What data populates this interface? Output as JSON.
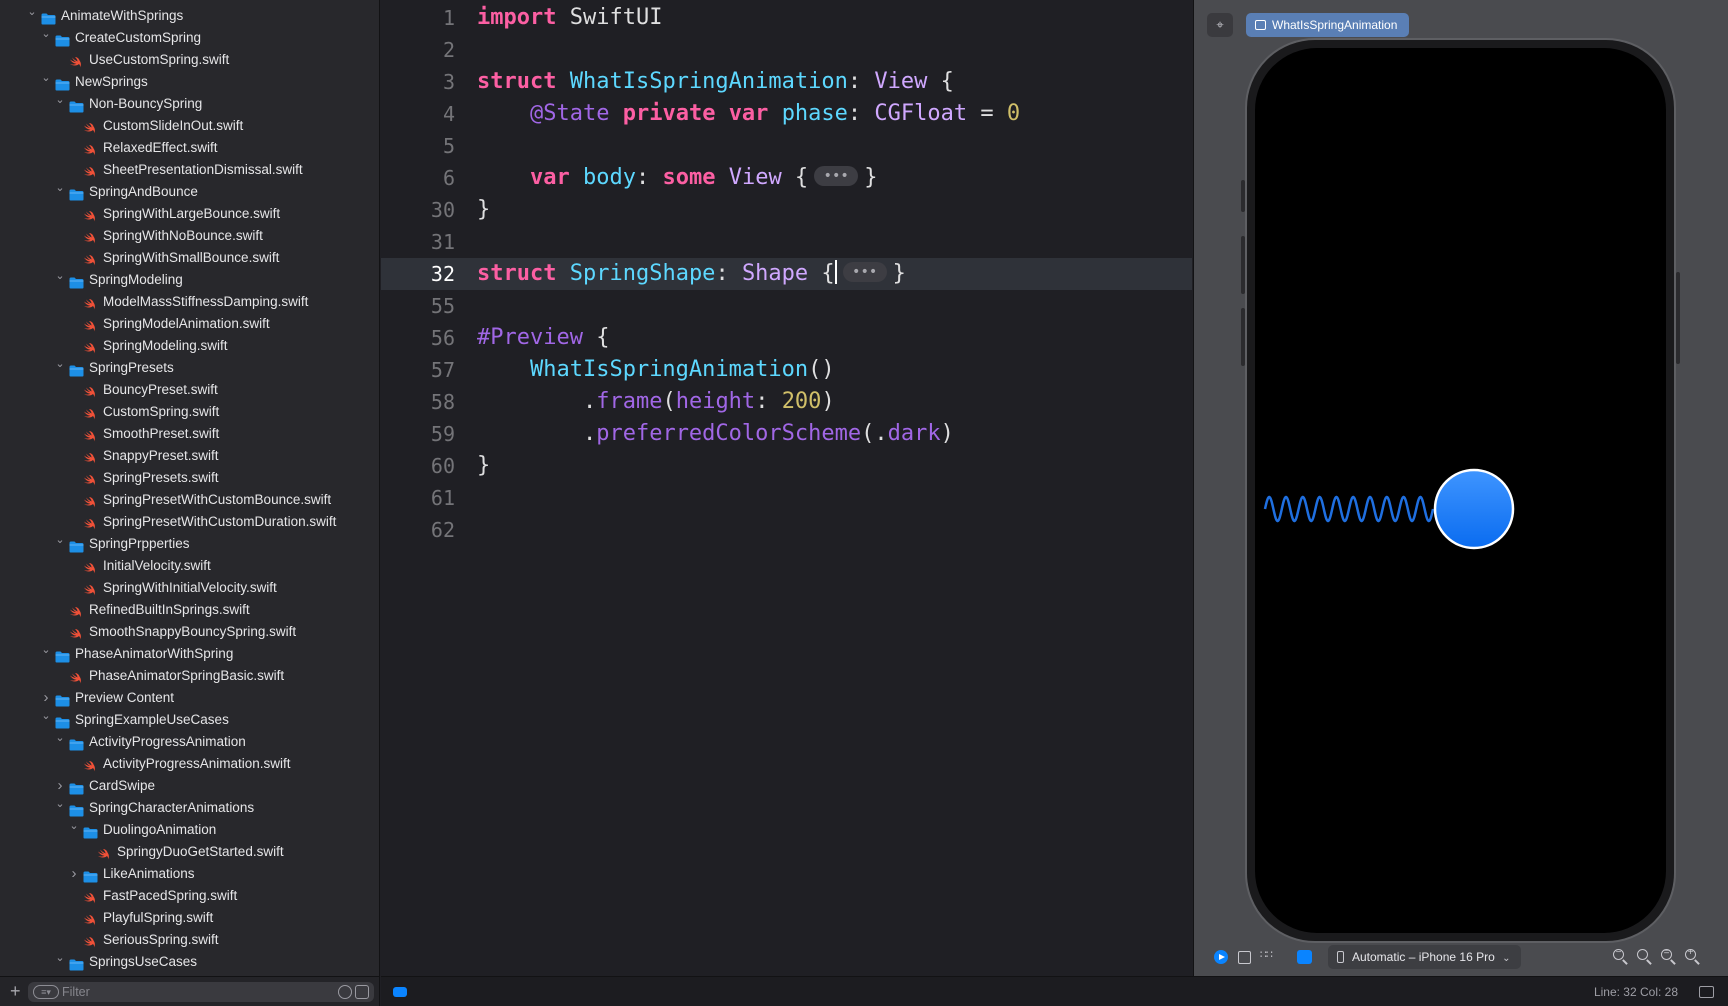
{
  "navigator": {
    "items": [
      {
        "label": "AnimateWithSprings",
        "type": "folder",
        "depth": 1,
        "expanded": true
      },
      {
        "label": "CreateCustomSpring",
        "type": "folder",
        "depth": 2,
        "expanded": true
      },
      {
        "label": "UseCustomSpring.swift",
        "type": "swift",
        "depth": 3
      },
      {
        "label": "NewSprings",
        "type": "folder",
        "depth": 2,
        "expanded": true
      },
      {
        "label": "Non-BouncySpring",
        "type": "folder",
        "depth": 3,
        "expanded": true
      },
      {
        "label": "CustomSlideInOut.swift",
        "type": "swift",
        "depth": 4
      },
      {
        "label": "RelaxedEffect.swift",
        "type": "swift",
        "depth": 4
      },
      {
        "label": "SheetPresentationDismissal.swift",
        "type": "swift",
        "depth": 4
      },
      {
        "label": "SpringAndBounce",
        "type": "folder",
        "depth": 3,
        "expanded": true
      },
      {
        "label": "SpringWithLargeBounce.swift",
        "type": "swift",
        "depth": 4
      },
      {
        "label": "SpringWithNoBounce.swift",
        "type": "swift",
        "depth": 4
      },
      {
        "label": "SpringWithSmallBounce.swift",
        "type": "swift",
        "depth": 4
      },
      {
        "label": "SpringModeling",
        "type": "folder",
        "depth": 3,
        "expanded": true
      },
      {
        "label": "ModelMassStiffnessDamping.swift",
        "type": "swift",
        "depth": 4
      },
      {
        "label": "SpringModelAnimation.swift",
        "type": "swift",
        "depth": 4
      },
      {
        "label": "SpringModeling.swift",
        "type": "swift",
        "depth": 4
      },
      {
        "label": "SpringPresets",
        "type": "folder",
        "depth": 3,
        "expanded": true
      },
      {
        "label": "BouncyPreset.swift",
        "type": "swift",
        "depth": 4
      },
      {
        "label": "CustomSpring.swift",
        "type": "swift",
        "depth": 4
      },
      {
        "label": "SmoothPreset.swift",
        "type": "swift",
        "depth": 4
      },
      {
        "label": "SnappyPreset.swift",
        "type": "swift",
        "depth": 4
      },
      {
        "label": "SpringPresets.swift",
        "type": "swift",
        "depth": 4
      },
      {
        "label": "SpringPresetWithCustomBounce.swift",
        "type": "swift",
        "depth": 4
      },
      {
        "label": "SpringPresetWithCustomDuration.swift",
        "type": "swift",
        "depth": 4
      },
      {
        "label": "SpringPrpperties",
        "type": "folder",
        "depth": 3,
        "expanded": true
      },
      {
        "label": "InitialVelocity.swift",
        "type": "swift",
        "depth": 4
      },
      {
        "label": "SpringWithInitialVelocity.swift",
        "type": "swift",
        "depth": 4
      },
      {
        "label": "RefinedBuiltInSprings.swift",
        "type": "swift",
        "depth": 3
      },
      {
        "label": "SmoothSnappyBouncySpring.swift",
        "type": "swift",
        "depth": 3
      },
      {
        "label": "PhaseAnimatorWithSpring",
        "type": "folder",
        "depth": 2,
        "expanded": true
      },
      {
        "label": "PhaseAnimatorSpringBasic.swift",
        "type": "swift",
        "depth": 3
      },
      {
        "label": "Preview Content",
        "type": "folder",
        "depth": 2,
        "expanded": false
      },
      {
        "label": "SpringExampleUseCases",
        "type": "folder",
        "depth": 2,
        "expanded": true
      },
      {
        "label": "ActivityProgressAnimation",
        "type": "folder",
        "depth": 3,
        "expanded": true
      },
      {
        "label": "ActivityProgressAnimation.swift",
        "type": "swift",
        "depth": 4
      },
      {
        "label": "CardSwipe",
        "type": "folder",
        "depth": 3,
        "expanded": false
      },
      {
        "label": "SpringCharacterAnimations",
        "type": "folder",
        "depth": 3,
        "expanded": true
      },
      {
        "label": "DuolingoAnimation",
        "type": "folder",
        "depth": 4,
        "expanded": true
      },
      {
        "label": "SpringyDuoGetStarted.swift",
        "type": "swift",
        "depth": 5
      },
      {
        "label": "LikeAnimations",
        "type": "folder",
        "depth": 4,
        "expanded": false
      },
      {
        "label": "FastPacedSpring.swift",
        "type": "swift",
        "depth": 4
      },
      {
        "label": "PlayfulSpring.swift",
        "type": "swift",
        "depth": 4
      },
      {
        "label": "SeriousSpring.swift",
        "type": "swift",
        "depth": 4
      },
      {
        "label": "SpringsUseCases",
        "type": "folder",
        "depth": 3,
        "expanded": true
      }
    ],
    "filter_placeholder": "Filter",
    "add_icon": "plus-icon"
  },
  "editor": {
    "current_line": "32",
    "lines": [
      {
        "num": "1",
        "tokens": [
          [
            "kw",
            "import"
          ],
          [
            "pl",
            " SwiftUI"
          ]
        ]
      },
      {
        "num": "2",
        "tokens": []
      },
      {
        "num": "3",
        "tokens": [
          [
            "kw",
            "struct"
          ],
          [
            "pl",
            " "
          ],
          [
            "tp",
            "WhatIsSpringAnimation"
          ],
          [
            "pl",
            ": "
          ],
          [
            "ty",
            "View"
          ],
          [
            "pl",
            " {"
          ]
        ]
      },
      {
        "num": "4",
        "tokens": [
          [
            "pl",
            "    "
          ],
          [
            "at",
            "@State"
          ],
          [
            "pl",
            " "
          ],
          [
            "kw",
            "private"
          ],
          [
            "pl",
            " "
          ],
          [
            "kw",
            "var"
          ],
          [
            "pl",
            " "
          ],
          [
            "prop",
            "phase"
          ],
          [
            "pl",
            ": "
          ],
          [
            "ty",
            "CGFloat"
          ],
          [
            "pl",
            " = "
          ],
          [
            "nm",
            "0"
          ]
        ]
      },
      {
        "num": "5",
        "tokens": []
      },
      {
        "num": "6",
        "tokens": [
          [
            "pl",
            "    "
          ],
          [
            "kw",
            "var"
          ],
          [
            "pl",
            " "
          ],
          [
            "prop",
            "body"
          ],
          [
            "pl",
            ": "
          ],
          [
            "kw",
            "some"
          ],
          [
            "pl",
            " "
          ],
          [
            "ty",
            "View"
          ],
          [
            "pl",
            " {"
          ],
          [
            "fold",
            "•••"
          ],
          [
            "pl",
            "}"
          ]
        ]
      },
      {
        "num": "30",
        "tokens": [
          [
            "pl",
            "}"
          ]
        ]
      },
      {
        "num": "31",
        "tokens": []
      },
      {
        "num": "32",
        "tokens": [
          [
            "kw",
            "struct"
          ],
          [
            "pl",
            " "
          ],
          [
            "tp",
            "SpringShape"
          ],
          [
            "pl",
            ": "
          ],
          [
            "ty",
            "Shape"
          ],
          [
            "pl",
            " {"
          ],
          [
            "caret",
            ""
          ],
          [
            "fold",
            "•••"
          ],
          [
            "pl",
            "}"
          ]
        ]
      },
      {
        "num": "55",
        "tokens": []
      },
      {
        "num": "56",
        "tokens": [
          [
            "fn",
            "#Preview"
          ],
          [
            "pl",
            " {"
          ]
        ]
      },
      {
        "num": "57",
        "tokens": [
          [
            "pl",
            "    "
          ],
          [
            "prop",
            "WhatIsSpringAnimation"
          ],
          [
            "pl",
            "()"
          ]
        ]
      },
      {
        "num": "58",
        "tokens": [
          [
            "pl",
            "        ."
          ],
          [
            "fn",
            "frame"
          ],
          [
            "pl",
            "("
          ],
          [
            "fn",
            "height"
          ],
          [
            "pl",
            ": "
          ],
          [
            "nm",
            "200"
          ],
          [
            "pl",
            ")"
          ]
        ]
      },
      {
        "num": "59",
        "tokens": [
          [
            "pl",
            "        ."
          ],
          [
            "fn",
            "preferredColorScheme"
          ],
          [
            "pl",
            "(."
          ],
          [
            "fn",
            "dark"
          ],
          [
            "pl",
            ")"
          ]
        ]
      },
      {
        "num": "60",
        "tokens": [
          [
            "pl",
            "}"
          ]
        ]
      },
      {
        "num": "61",
        "tokens": []
      },
      {
        "num": "62",
        "tokens": []
      }
    ]
  },
  "canvas": {
    "preview_tab": "WhatIsSpringAnimation",
    "pin_icon": "pin-icon",
    "device": "Automatic – iPhone 16 Pro",
    "toolbar_icons": [
      "live-preview-icon",
      "selectable-icon",
      "variants-icon",
      "device-settings-icon"
    ],
    "zoom_icons": [
      "zoom-out-icon",
      "zoom-fit-icon",
      "zoom-actual-icon",
      "zoom-in-icon"
    ]
  },
  "status": {
    "position": "Line: 32  Col: 28"
  },
  "colors": {
    "keyword": "#fc5fa3",
    "type_decl": "#5dd8ff",
    "type_ref": "#d0a8ff",
    "number": "#d0bf69",
    "folder": "#1d8fe6",
    "swift": "#f05138",
    "accent": "#0a84ff",
    "spring": "#1f6fe0"
  }
}
